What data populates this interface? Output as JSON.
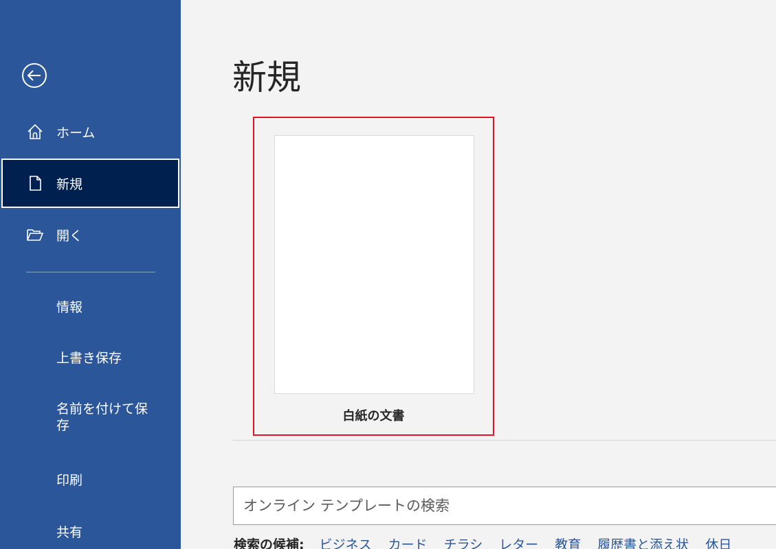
{
  "sidebar": {
    "background": "#2b579a",
    "selected_background": "#002050",
    "back_icon": "back-arrow-icon",
    "nav": {
      "home": {
        "label": "ホーム",
        "icon": "home-icon"
      },
      "new": {
        "label": "新規",
        "icon": "new-document-icon"
      },
      "open": {
        "label": "開く",
        "icon": "folder-open-icon"
      }
    },
    "items": {
      "info": "情報",
      "save": "上書き保存",
      "save_as": "名前を付けて保存",
      "print": "印刷",
      "share": "共有"
    }
  },
  "main": {
    "title": "新規",
    "blank_template": {
      "label": "白紙の文書",
      "highlight_color": "#e81123"
    },
    "search": {
      "placeholder": "オンライン テンプレートの検索"
    },
    "suggestions": {
      "label": "検索の候補:",
      "items": [
        "ビジネス",
        "カード",
        "チラシ",
        "レター",
        "教育",
        "履歴書と添え状",
        "休日"
      ]
    }
  }
}
